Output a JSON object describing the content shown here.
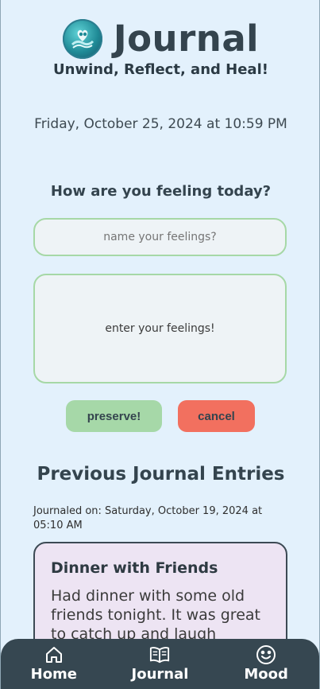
{
  "header": {
    "app_title": "Journal",
    "tagline": "Unwind, Reflect, and Heal!"
  },
  "datetime": "Friday, October 25, 2024 at 10:59 PM",
  "form": {
    "prompt": "How are you feeling today?",
    "name_placeholder": "name your feelings?",
    "feelings_placeholder": "enter your feelings!",
    "preserve_label": "preserve!",
    "cancel_label": "cancel"
  },
  "previous": {
    "title": "Previous Journal Entries",
    "entries": [
      {
        "meta": "Journaled on: Saturday, October 19, 2024 at 05:10 AM",
        "title": "Dinner with Friends",
        "body": "Had dinner with some old friends tonight. It was great to catch up and laugh"
      }
    ]
  },
  "nav": {
    "items": [
      {
        "label": "Home",
        "icon": "home-icon"
      },
      {
        "label": "Journal",
        "icon": "book-icon"
      },
      {
        "label": "Mood",
        "icon": "smiley-icon"
      }
    ]
  },
  "colors": {
    "background": "#e3f1fc",
    "accent_green": "#a6d8a8",
    "cancel_red": "#f2705f",
    "nav_bg": "#364751",
    "card_bg": "#ede4f3"
  }
}
